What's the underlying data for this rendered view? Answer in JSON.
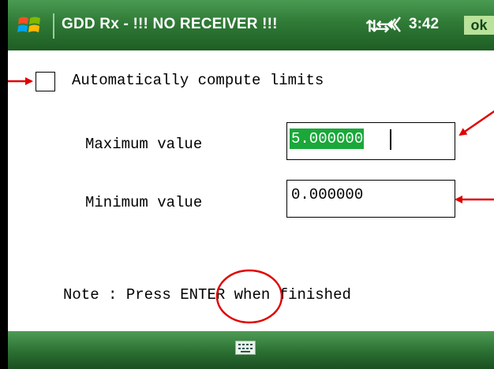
{
  "titlebar": {
    "app_title": "GDD Rx - !!! NO RECEIVER !!!",
    "clock": "3:42",
    "ok_label": "ok",
    "icons": [
      "windows-start-icon",
      "connectivity-icon",
      "volume-icon"
    ]
  },
  "form": {
    "auto_limits": {
      "label": "Automatically compute limits",
      "checked": false
    },
    "maximum": {
      "label": "Maximum value",
      "value": "5.000000",
      "focused": true
    },
    "minimum": {
      "label": "Minimum value",
      "value": "0.000000"
    },
    "note": {
      "prefix": "Note : Press ",
      "key": "ENTER",
      "suffix": " when finished"
    }
  },
  "bottombar": {
    "icons": [
      "keyboard-icon"
    ]
  },
  "colors": {
    "bar_green": "#2f7a36",
    "selection_green": "#1aa83a",
    "annotation_red": "#e00000"
  }
}
